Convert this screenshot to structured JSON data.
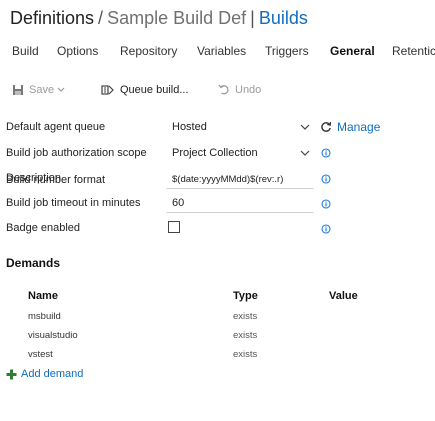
{
  "breadcrumb": {
    "root": "Definitions",
    "separator": "/",
    "definition": "Sample Build Def",
    "separator2": "|",
    "builds_link": "Builds"
  },
  "tabs": [
    {
      "label": "Build",
      "active": false
    },
    {
      "label": "Options",
      "active": false
    },
    {
      "label": "Repository",
      "active": false
    },
    {
      "label": "Variables",
      "active": false
    },
    {
      "label": "Triggers",
      "active": false
    },
    {
      "label": "General",
      "active": true
    },
    {
      "label": "Retentic",
      "active": false
    }
  ],
  "toolbar": {
    "save_label": "Save",
    "queue_label": "Queue build...",
    "undo_label": "Undo",
    "icons": {
      "save": "save-icon",
      "queue": "queue-build-icon",
      "undo": "undo-icon"
    }
  },
  "general": {
    "default_agent_queue": {
      "label": "Default agent queue",
      "value": "Hosted",
      "manage_label": "Manage"
    },
    "auth_scope": {
      "label": "Build job authorization scope",
      "value": "Project Collection"
    },
    "description": {
      "label": "Description",
      "value": ""
    },
    "build_number_format": {
      "label": "Build number format",
      "value": "$(date:yyyyMMdd)$(rev:.r)"
    },
    "timeout": {
      "label": "Build job timeout in minutes",
      "value": "60"
    },
    "badge_enabled": {
      "label": "Badge enabled",
      "checked": false
    }
  },
  "demands": {
    "title": "Demands",
    "columns": [
      "Name",
      "Type",
      "Value"
    ],
    "rows": [
      {
        "name": "msbuild",
        "type": "exists",
        "value": ""
      },
      {
        "name": "visualstudio",
        "type": "exists",
        "value": ""
      },
      {
        "name": "vstest",
        "type": "exists",
        "value": ""
      }
    ],
    "add_label": "Add demand"
  },
  "colors": {
    "accent": "#106ebe",
    "info": "#1b7ed6"
  }
}
